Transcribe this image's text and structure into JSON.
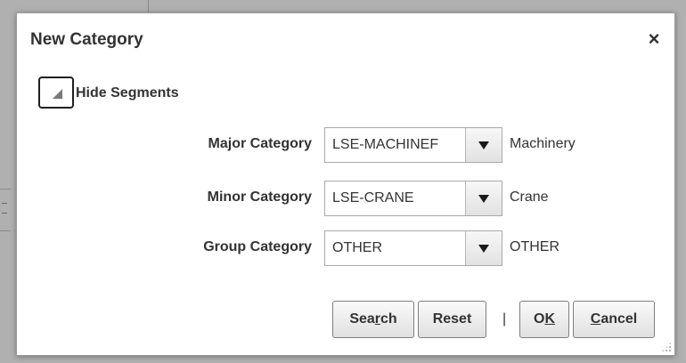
{
  "dialog": {
    "title": "New Category",
    "close_glyph": "×"
  },
  "disclosure": {
    "label": "Hide Segments",
    "state": "expanded"
  },
  "fields": [
    {
      "label": "Major Category",
      "value": "LSE-MACHINERY",
      "visible_value": "LSE-MACHINEF",
      "description": "Machinery"
    },
    {
      "label": "Minor Category",
      "value": "LSE-CRANE",
      "visible_value": "LSE-CRANE",
      "description": "Crane"
    },
    {
      "label": "Group Category",
      "value": "OTHER",
      "visible_value": "OTHER",
      "description": "OTHER"
    }
  ],
  "buttons": {
    "search_pre": "Sea",
    "search_key": "r",
    "search_post": "ch",
    "reset": "Reset",
    "separator": "|",
    "ok_pre": "O",
    "ok_key": "K",
    "ok_post": "",
    "cancel_key": "C",
    "cancel_post": "ancel"
  },
  "icons": {
    "close": "close-icon",
    "disclosure": "triangle-expanded-icon",
    "dropdown": "chevron-down-icon",
    "resize": "resize-grip-icon"
  }
}
